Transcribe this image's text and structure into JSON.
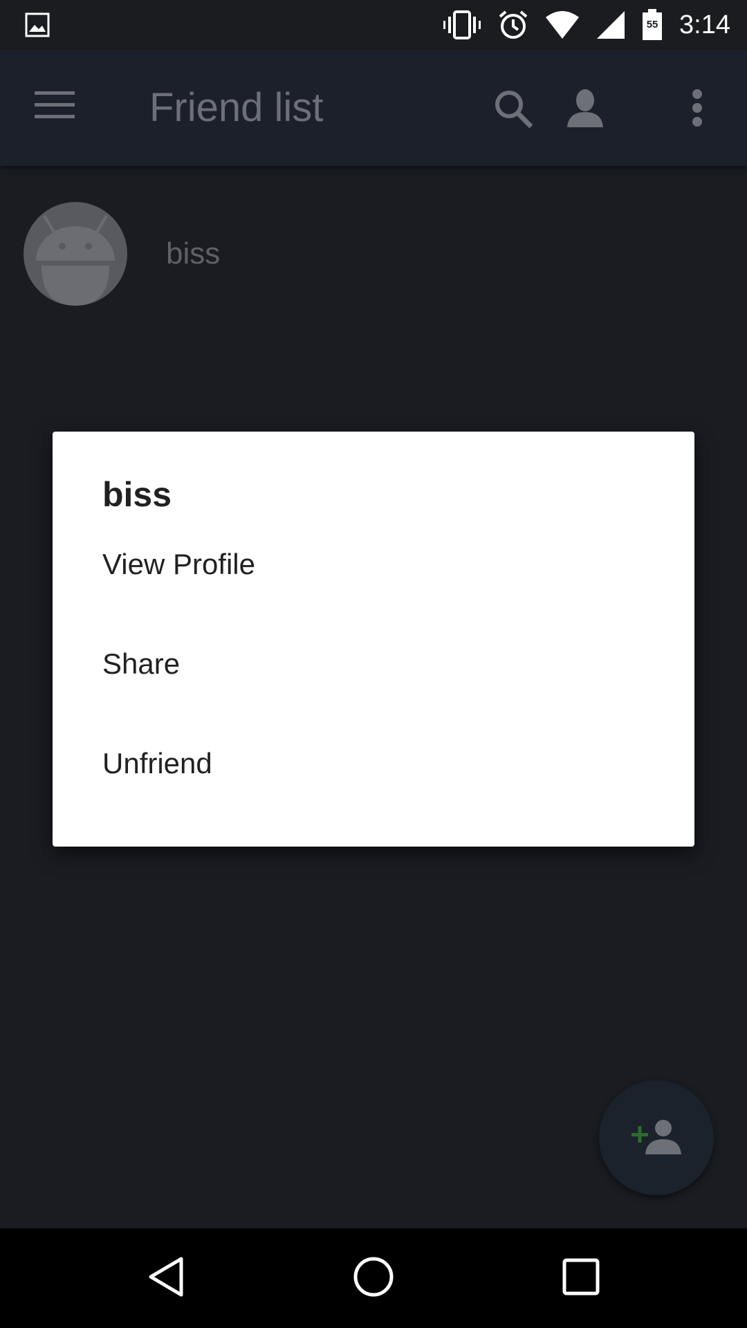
{
  "status_bar": {
    "time": "3:14",
    "battery_level": "55",
    "icons": [
      "image-notification-icon",
      "vibrate-icon",
      "alarm-icon",
      "wifi-icon",
      "cell-signal-icon",
      "battery-icon"
    ]
  },
  "toolbar": {
    "title": "Friend list",
    "icons": [
      "menu-icon",
      "search-icon",
      "account-icon",
      "more-vert-icon"
    ]
  },
  "friends": [
    {
      "name": "biss",
      "avatar": "android-avatar-icon"
    }
  ],
  "dialog": {
    "title": "biss",
    "items": [
      {
        "label": "View Profile"
      },
      {
        "label": "Share"
      },
      {
        "label": "Unfriend"
      }
    ]
  },
  "fab": {
    "icon": "add-friend-icon"
  },
  "colors": {
    "status_bar": "#1a1c20",
    "toolbar": "#1b202b",
    "background": "#1a1c22",
    "dialog": "#ffffff",
    "dialog_text": "#212121",
    "fab_plus": "#2e6b2e"
  }
}
